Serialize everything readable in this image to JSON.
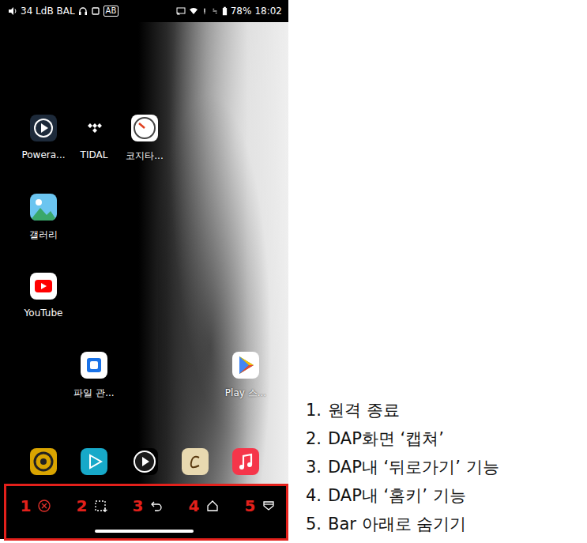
{
  "status_bar": {
    "audio": "34 LdB BAL",
    "mode": "AB",
    "battery": "78%",
    "time": "18:02"
  },
  "apps": [
    {
      "label": "Powera..."
    },
    {
      "label": "TIDAL"
    },
    {
      "label": "코지타..."
    },
    {
      "label": "갤러리"
    },
    {
      "label": "YouTube"
    },
    {
      "label": "파일 관..."
    },
    {
      "label": "Play 스..."
    }
  ],
  "control_bar": {
    "buttons": [
      {
        "number": "1"
      },
      {
        "number": "2"
      },
      {
        "number": "3"
      },
      {
        "number": "4"
      },
      {
        "number": "5"
      }
    ]
  },
  "legend": [
    {
      "number": "1.",
      "text": "원격 종료"
    },
    {
      "number": "2.",
      "text": "DAP화면 ‘캡쳐’"
    },
    {
      "number": "3.",
      "text": "DAP내 ‘뒤로가기’ 기능"
    },
    {
      "number": "4.",
      "text": "DAP내 ‘홈키’ 기능"
    },
    {
      "number": "5.",
      "text": "Bar 아래로 숨기기"
    }
  ]
}
